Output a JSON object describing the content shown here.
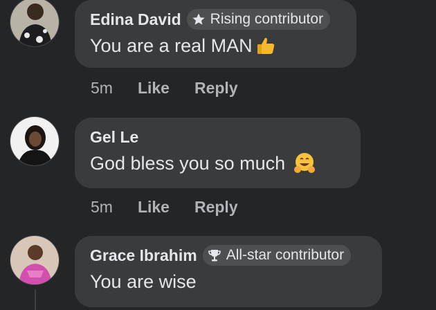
{
  "comments": [
    {
      "author": "Edina David",
      "badge": "Rising contributor",
      "badge_icon": "star-icon",
      "text": "You are a real MAN",
      "emoji": "thumbs-up-icon",
      "time": "5m",
      "like": "Like",
      "reply": "Reply"
    },
    {
      "author": "Gel Le",
      "text": "God bless you so much",
      "emoji": "hugging-face-icon",
      "time": "5m",
      "like": "Like",
      "reply": "Reply"
    },
    {
      "author": "Grace Ibrahim",
      "badge": "All-star contributor",
      "badge_icon": "trophy-icon",
      "text": "You are wise"
    }
  ],
  "colors": {
    "background": "#242526",
    "bubble": "#3a3b3c",
    "primary_text": "#e4e6eb",
    "secondary_text": "#b0b3b8"
  }
}
